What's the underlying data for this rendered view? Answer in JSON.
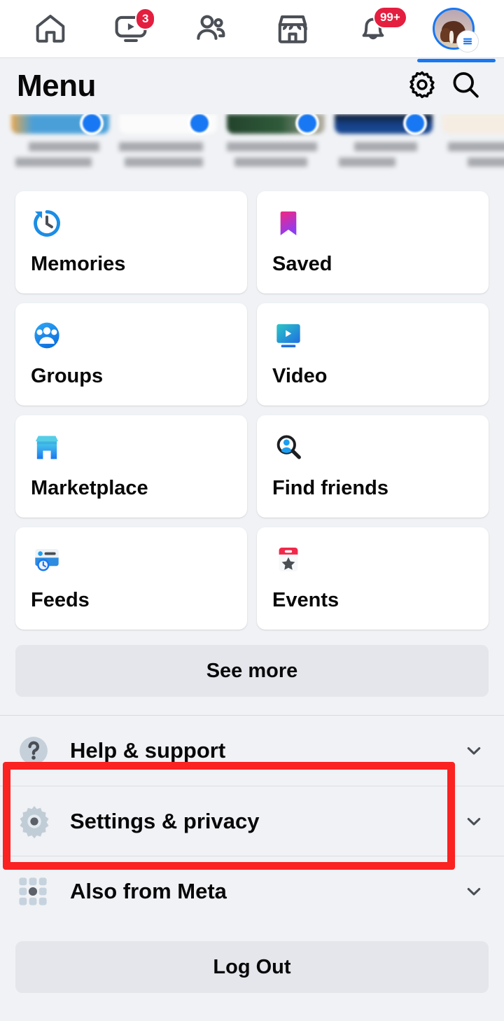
{
  "topnav": {
    "items": [
      {
        "name": "home",
        "icon": "home-icon",
        "badge": null,
        "active": false
      },
      {
        "name": "video",
        "icon": "video-icon",
        "badge": "3",
        "active": false
      },
      {
        "name": "friends",
        "icon": "friends-icon",
        "badge": null,
        "active": false
      },
      {
        "name": "marketplace",
        "icon": "marketplace-icon",
        "badge": null,
        "active": false
      },
      {
        "name": "notifications",
        "icon": "bell-icon",
        "badge": "99+",
        "active": false
      },
      {
        "name": "menu",
        "icon": "profile-avatar",
        "badge": null,
        "active": true
      }
    ]
  },
  "header": {
    "title": "Menu",
    "settings_icon": "gear-icon",
    "search_icon": "search-icon"
  },
  "shortcuts": {
    "blurred": true,
    "items": [
      {
        "line1": "",
        "line2": "",
        "color": "#4a9fd8"
      },
      {
        "line1": "",
        "line2": "",
        "color": "#f7f7f7"
      },
      {
        "line1": "",
        "line2": "",
        "color": "#23432c"
      },
      {
        "line1": "",
        "line2": "",
        "color": "#17458f"
      },
      {
        "line1": "",
        "line2": "",
        "color": "#f5ece2"
      }
    ]
  },
  "tiles": [
    {
      "label": "Memories",
      "icon": "memories-clock-icon"
    },
    {
      "label": "Saved",
      "icon": "saved-bookmark-icon"
    },
    {
      "label": "Groups",
      "icon": "groups-people-icon"
    },
    {
      "label": "Video",
      "icon": "video-monitor-icon"
    },
    {
      "label": "Marketplace",
      "icon": "marketplace-storefront-icon"
    },
    {
      "label": "Find friends",
      "icon": "find-friends-magnifier-icon"
    },
    {
      "label": "Feeds",
      "icon": "feeds-card-clock-icon"
    },
    {
      "label": "Events",
      "icon": "events-calendar-star-icon"
    }
  ],
  "see_more_label": "See more",
  "rows": [
    {
      "label": "Help & support",
      "icon": "question-mark-circle-icon",
      "chevron": "chevron-down-icon"
    },
    {
      "label": "Settings & privacy",
      "icon": "gear-icon",
      "chevron": "chevron-down-icon"
    },
    {
      "label": "Also from Meta",
      "icon": "meta-apps-grid-icon",
      "chevron": "chevron-down-icon"
    }
  ],
  "log_out_label": "Log Out",
  "annotation": {
    "type": "highlight-box",
    "target": "Settings & privacy",
    "color": "#fb2222"
  },
  "colors": {
    "page_background": "#f0f2f5",
    "card_background": "#ffffff",
    "accent_blue": "#1877f2",
    "badge_red": "#e41e3f",
    "button_gray": "#e4e6eb",
    "text_primary": "#080809"
  }
}
